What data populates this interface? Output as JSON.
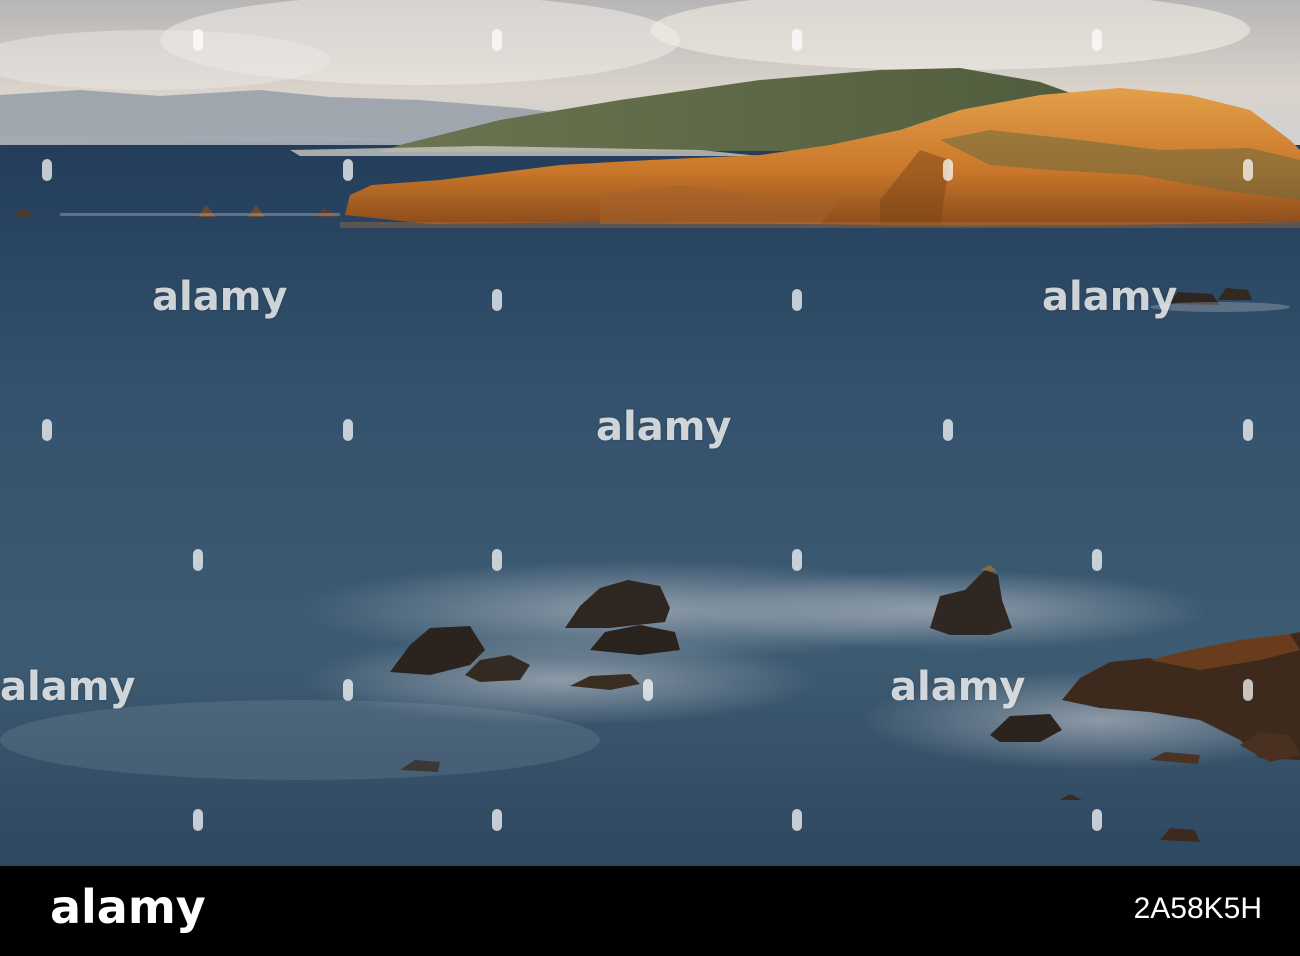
{
  "image": {
    "scene": "long exposure seascape with golden sunlit headland and dark rocks",
    "watermark_text": "alamy",
    "footer": {
      "brand": "alamy",
      "image_id": "2A58K5H"
    }
  },
  "colors": {
    "sky_top": "#c9c7c4",
    "sea": "#2b4a66",
    "cliff_gold": "#d4892e",
    "hill_green": "#5b6a45",
    "rock_dark": "#2b241f",
    "footer_bg": "#000000"
  }
}
